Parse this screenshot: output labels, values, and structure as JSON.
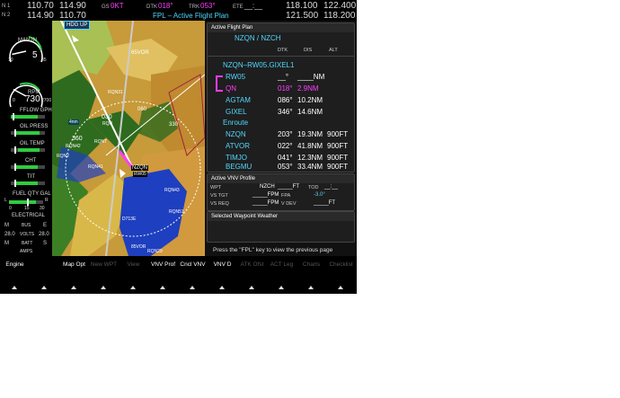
{
  "topbar": {
    "nav_label_1": "N 1",
    "nav_label_2": "N 2",
    "nav1_active": "110.70",
    "nav1_standby": "114.90",
    "nav2_active": "114.90",
    "nav2_standby": "110.70",
    "gs_label": "GS",
    "gs_value": "0KT",
    "dtk_label": "DTK",
    "dtk_value": "018°",
    "trk_label": "TRK",
    "trk_value": "053°",
    "ete_label": "ETE",
    "ete_value": "__:__",
    "page_title": "FPL – Active Flight Plan",
    "com1_active": "118.100",
    "com1_standby": "122.400",
    "com2_active": "121.500",
    "com2_standby": "118.200"
  },
  "engine": {
    "manin_label": "MAN IN",
    "manin_value": "5",
    "manin_min": "10",
    "manin_max": "35",
    "rpm_label": "RPM",
    "rpm_value": "730",
    "rpm_min": "0",
    "rpm_max": "2700",
    "ff_label": "FFLOW GPH",
    "oilp_label": "OIL PRESS",
    "oilt_label": "OIL TEMP",
    "cht_label": "CHT",
    "tit_label": "TIT",
    "fuel_label": "FUEL QTY GAL",
    "fuel_left": "L",
    "fuel_right": "R",
    "fuel_0": "0",
    "fuel_mid": "15",
    "fuel_max": "30",
    "electrical_label": "ELECTRICAL",
    "elec_rows": [
      {
        "left": "M",
        "label": "BUS",
        "right": "E"
      },
      {
        "left": "28.0",
        "label": "VOLTS",
        "right": "28.0"
      },
      {
        "left": "M",
        "label": "BATT",
        "right": "S"
      },
      {
        "left": "",
        "label": "AMPS",
        "right": ""
      }
    ],
    "manin_fraction": 0.12,
    "rpm_fraction": 0.27
  },
  "map": {
    "orientation": "HDG UP",
    "labels": {
      "vor": "65VOR",
      "vor2": "85VOR",
      "n060": "060",
      "n030": "030",
      "n330": "330",
      "n360": "360",
      "nzqn": "NZQN",
      "rw05": "RW05",
      "rqn": "RQN",
      "rqn29": "RQN29",
      "rqn43": "RQN43",
      "rqn1": "RQNT",
      "nzch": "NZCH",
      "agtam": "AGTAM",
      "p1": "RQN43",
      "p2": "RQN42",
      "p3": "RQN2",
      "p4": "D713E",
      "p5": "RQN31",
      "p6": "RQN51",
      "p7": "RQN41",
      "p8": "RQN52",
      "p9": "RQN3",
      "p10": "RQN25",
      "p11": "RQN44",
      "p12": "RQN13",
      "p13": "RQN7",
      "p14": "RQN53",
      "p15": "RQN81",
      "p16": "4nm"
    },
    "colors": {
      "water": "#1e3fbf",
      "terrain_green": "#2e6b1e",
      "terrain_yellow": "#d9b84a",
      "route": "#ff3cff",
      "range_ring": "#ffffff"
    }
  },
  "fpl": {
    "header": "Active Flight Plan",
    "route_title": "NZQN / NZCH",
    "cols": {
      "dtk": "DTK",
      "dis": "DIS",
      "alt": "ALT"
    },
    "procedure": "NZQN–RW05.GIXEL1",
    "rows": [
      {
        "name": "RW05",
        "dtk": "__°",
        "dis": "____NM",
        "alt": "",
        "color": "cyan",
        "active": false
      },
      {
        "name": "QN",
        "dtk": "018°",
        "dis": "2.9NM",
        "alt": "",
        "color": "magenta",
        "active": true
      },
      {
        "name": "AGTAM",
        "dtk": "086°",
        "dis": "10.2NM",
        "alt": "",
        "color": "cyan",
        "active": false
      },
      {
        "name": "GIXEL",
        "dtk": "346°",
        "dis": "14.6NM",
        "alt": "",
        "color": "cyan",
        "active": false
      }
    ],
    "enroute_label": "Enroute",
    "enroute_rows": [
      {
        "name": "NZQN",
        "dtk": "203°",
        "dis": "19.3NM",
        "alt": "900FT"
      },
      {
        "name": "ATVOR",
        "dtk": "022°",
        "dis": "41.8NM",
        "alt": "900FT"
      },
      {
        "name": "TIMJO",
        "dtk": "041°",
        "dis": "12.3NM",
        "alt": "900FT"
      },
      {
        "name": "BEGMU",
        "dtk": "053°",
        "dis": "33.4NM",
        "alt": "900FT"
      }
    ],
    "vnv": {
      "header": "Active VNV Profile",
      "wpt_label": "WPT",
      "wpt_value": "NZCH",
      "wpt_alt": "_____FT",
      "tod_label": "TOD",
      "tod_value": "__:__",
      "vstgt_label": "VS TGT",
      "vstgt_value": "_____FPM",
      "fpa_label": "FPA",
      "fpa_value": "-3.0°",
      "vsreq_label": "VS REQ",
      "vsreq_value": "_____FPM",
      "vdev_label": "V DEV",
      "vdev_value": "_____FT"
    },
    "weather_header": "Selected Waypoint Weather",
    "footer_hint": "Press the \"FPL\" key to view the previous page"
  },
  "softkeys": [
    {
      "label": "Engine",
      "enabled": true
    },
    {
      "label": "",
      "enabled": true
    },
    {
      "label": "Map Opt",
      "enabled": true
    },
    {
      "label": "New WPT",
      "enabled": false
    },
    {
      "label": "View",
      "enabled": false
    },
    {
      "label": "VNV Prof",
      "enabled": true
    },
    {
      "label": "Cncl VNV",
      "enabled": true
    },
    {
      "label": "VNV D",
      "enabled": true
    },
    {
      "label": "ATK Ofst",
      "enabled": false
    },
    {
      "label": "ACT Leg",
      "enabled": false
    },
    {
      "label": "Charts",
      "enabled": false
    },
    {
      "label": "Checklist",
      "enabled": false
    }
  ]
}
